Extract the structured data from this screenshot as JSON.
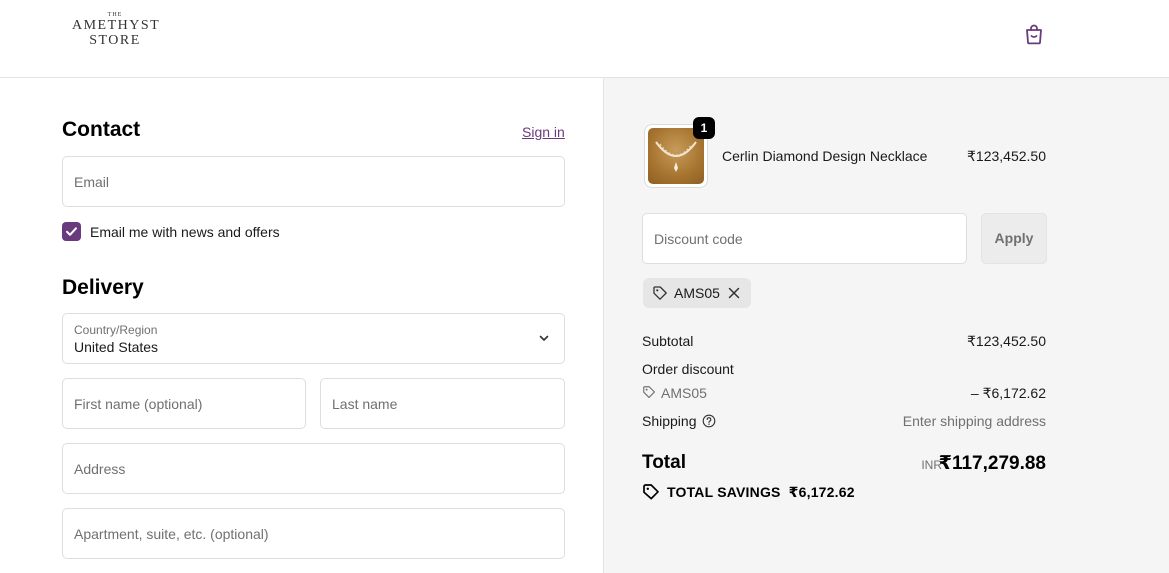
{
  "header": {
    "logo": {
      "small": "THE",
      "line1": "AMETHYST",
      "line2": "STORE"
    },
    "cart_icon": "shopping-bag-icon"
  },
  "contact": {
    "heading": "Contact",
    "sign_in": "Sign in",
    "email_placeholder": "Email",
    "newsletter_label": "Email me with news and offers",
    "newsletter_checked": true
  },
  "delivery": {
    "heading": "Delivery",
    "country_label": "Country/Region",
    "country_value": "United States",
    "first_name_placeholder": "First name (optional)",
    "last_name_placeholder": "Last name",
    "address_placeholder": "Address",
    "apartment_placeholder": "Apartment, suite, etc. (optional)"
  },
  "summary": {
    "product": {
      "name": "Cerlin Diamond Design Necklace",
      "price": "₹123,452.50",
      "quantity": "1"
    },
    "discount_placeholder": "Discount code",
    "apply_label": "Apply",
    "applied_code": "AMS05",
    "subtotal_label": "Subtotal",
    "subtotal_value": "₹123,452.50",
    "order_discount_label": "Order discount",
    "discount_code": "AMS05",
    "discount_value": "– ₹6,172.62",
    "shipping_label": "Shipping",
    "shipping_value": "Enter shipping address",
    "total_label": "Total",
    "currency": "INR",
    "total_value": "₹117,279.88",
    "savings_label": "TOTAL SAVINGS",
    "savings_value": "₹6,172.62"
  },
  "colors": {
    "accent": "#6a3b7c",
    "summary_bg": "#f5f5f5"
  }
}
